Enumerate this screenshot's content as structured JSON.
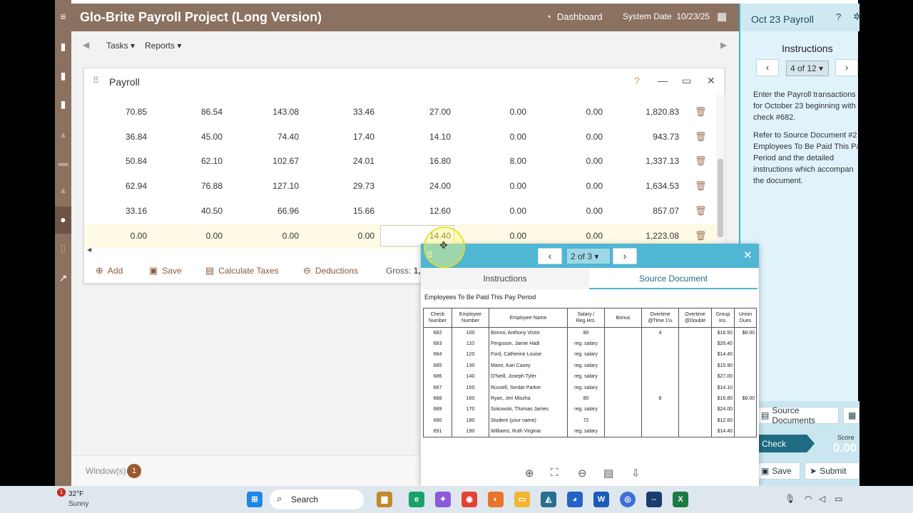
{
  "app": {
    "title": "Glo-Brite Payroll Project (Long Version)",
    "dashboard_label": "Dashboard",
    "system_date_label": "System Date",
    "system_date": "10/23/25"
  },
  "toolbar": {
    "tasks_label": "Tasks",
    "reports_label": "Reports"
  },
  "payroll_window": {
    "title": "Payroll",
    "rows": [
      [
        "70.85",
        "86.54",
        "143.08",
        "33.46",
        "27.00",
        "0.00",
        "0.00",
        "1,820.83"
      ],
      [
        "36.84",
        "45.00",
        "74.40",
        "17.40",
        "14.10",
        "0.00",
        "0.00",
        "943.73"
      ],
      [
        "50.84",
        "62.10",
        "102.67",
        "24.01",
        "16.80",
        "8.00",
        "0.00",
        "1,337.13"
      ],
      [
        "62.94",
        "76.88",
        "127.10",
        "29.73",
        "24.00",
        "0.00",
        "0.00",
        "1,634.53"
      ],
      [
        "33.16",
        "40.50",
        "66.96",
        "15.66",
        "12.60",
        "0.00",
        "0.00",
        "857.07"
      ],
      [
        "0.00",
        "0.00",
        "0.00",
        "0.00",
        "14.40",
        "0.00",
        "0.00",
        "1,223.08"
      ]
    ],
    "footer": {
      "add": "Add",
      "save": "Save",
      "calculate_taxes": "Calculate Taxes",
      "deductions": "Deductions",
      "gross_label": "Gross:",
      "gross_value": "1,2"
    }
  },
  "windows_bar": {
    "label": "Window(s)",
    "count": "1"
  },
  "right_panel": {
    "title": "Oct 23 Payroll",
    "instructions_heading": "Instructions",
    "page": "4 of 12",
    "text_lines": [
      "Enter the Payroll transactions",
      "for October 23 beginning with",
      "check #682.",
      "Refer to Source Document #2",
      "Employees To Be Paid This Pa",
      "Period and the detailed",
      "instructions which accompan",
      "the document."
    ],
    "source_documents_button": "Source Documents",
    "check_button": "Check",
    "score_label": "Score",
    "score_value": "0.00",
    "save_button": "Save",
    "submit_button": "Submit"
  },
  "popup": {
    "page": "2 of 3",
    "tab_instructions": "Instructions",
    "tab_source": "Source Document",
    "doc_title": "Employees To Be Paid This Pay Period",
    "headers": [
      "Check\nNumber",
      "Employee\nNumber",
      "Employee Name",
      "Salary /\nReg.Hrs.",
      "Bonus",
      "Overtime\n@Time 1½",
      "Overtime\n@Double",
      "Group\nIns.",
      "Union\nDues"
    ],
    "rows": [
      [
        "682",
        "100",
        "Bonno, Anthony Victor",
        "80",
        "",
        "4",
        "",
        "$16.50",
        "$8.00"
      ],
      [
        "683",
        "110",
        "Ferguson, Jamie Hadi",
        "reg. salary",
        "",
        "",
        "",
        "$26.40",
        ""
      ],
      [
        "684",
        "120",
        "Ford, Catherine Louise",
        "reg. salary",
        "",
        "",
        "",
        "$14.40",
        ""
      ],
      [
        "685",
        "130",
        "Mann, Kari Casey",
        "reg. salary",
        "",
        "",
        "",
        "$15.90",
        ""
      ],
      [
        "686",
        "140",
        "O'Neill, Joseph Tyler",
        "reg. salary",
        "",
        "",
        "",
        "$27.00",
        ""
      ],
      [
        "687",
        "150",
        "Russell, Serdar Parker",
        "reg. salary",
        "",
        "",
        "",
        "$14.10",
        ""
      ],
      [
        "688",
        "160",
        "Ryan, Jeri Mischa",
        "80",
        "",
        "8",
        "",
        "$16.80",
        "$8.00"
      ],
      [
        "689",
        "170",
        "Sokowski, Thomas James",
        "reg. salary",
        "",
        "",
        "",
        "$24.00",
        ""
      ],
      [
        "690",
        "180",
        "Student (your name)",
        "72",
        "",
        "",
        "",
        "$12.60",
        ""
      ],
      [
        "691",
        "190",
        "Williams, Ruth Virginia",
        "reg. salary",
        "",
        "",
        "",
        "$14.40",
        ""
      ]
    ]
  },
  "taskbar": {
    "weather_temp": "32°F",
    "weather_cond": "Sunny",
    "weather_badge": "1",
    "search_label": "Search"
  },
  "colors": {
    "brand": "#8a7160",
    "accent": "#4fb7d3",
    "panel": "#e0f3fb"
  }
}
